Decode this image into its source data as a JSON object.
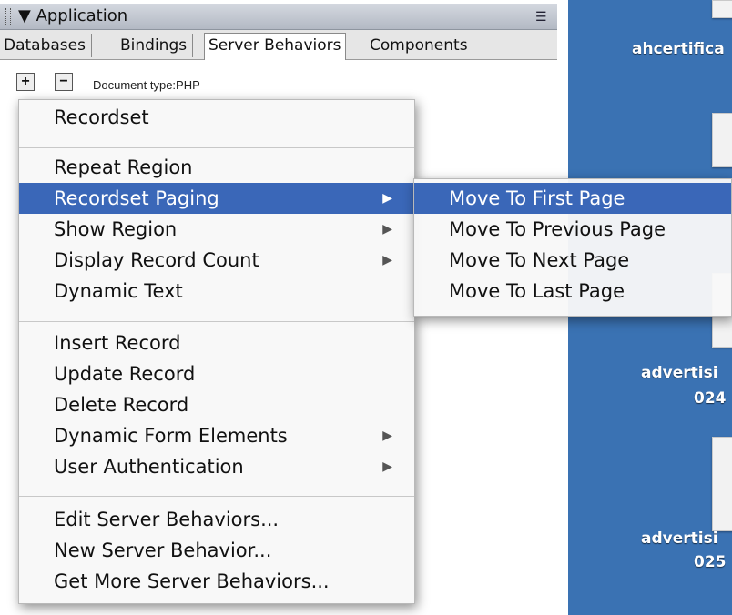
{
  "panel": {
    "title": "▼ Application",
    "tabs": [
      {
        "label": "Databases"
      },
      {
        "label": "Bindings"
      },
      {
        "label": "Server Behaviors",
        "active": true
      },
      {
        "label": "Components"
      }
    ],
    "add_button": "+",
    "remove_button": "−",
    "document_type": "Document type:PHP"
  },
  "menu": {
    "items": [
      {
        "label": "Recordset"
      },
      {
        "label": "Repeat Region"
      },
      {
        "label": "Recordset Paging",
        "highlighted": true,
        "submenu": true
      },
      {
        "label": "Show Region",
        "submenu": true
      },
      {
        "label": "Display Record Count",
        "submenu": true
      },
      {
        "label": "Dynamic Text"
      },
      {
        "label": "Insert Record"
      },
      {
        "label": "Update Record"
      },
      {
        "label": "Delete Record"
      },
      {
        "label": "Dynamic Form Elements",
        "submenu": true
      },
      {
        "label": "User Authentication",
        "submenu": true
      },
      {
        "label": "Edit Server Behaviors..."
      },
      {
        "label": "New Server Behavior..."
      },
      {
        "label": "Get More Server Behaviors..."
      }
    ]
  },
  "submenu": {
    "items": [
      {
        "label": "Move To First Page",
        "highlighted": true
      },
      {
        "label": "Move To Previous Page"
      },
      {
        "label": "Move To Next Page"
      },
      {
        "label": "Move To Last Page"
      }
    ]
  },
  "desktop": {
    "labels": [
      "ahcertifica",
      "advertisi",
      "024",
      "advertisi",
      "025"
    ]
  },
  "colors": {
    "highlight": "#3a67b8",
    "desktop": "#3a72b3"
  }
}
